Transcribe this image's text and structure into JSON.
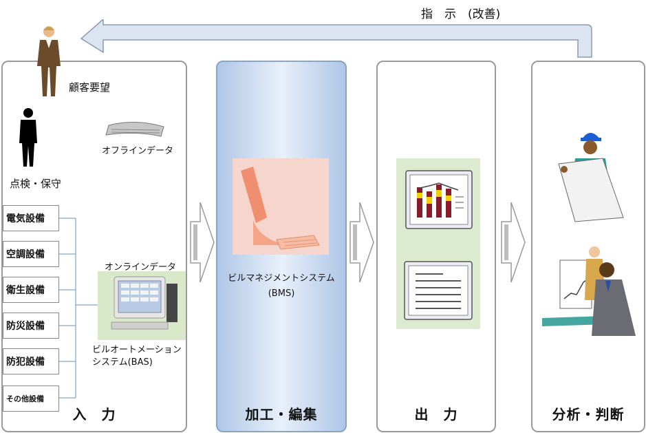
{
  "feedback": {
    "label": "指　示　(改善)"
  },
  "panels": {
    "input": {
      "title": "入　力",
      "customer_label": "顧客要望",
      "inspection_label": "点検・保守",
      "offline_label": "オフラインデータ",
      "online_label": "オンラインデータ",
      "bas_label": "ビルオートメーション\nシステム(BAS)",
      "equipment": [
        "電気設備",
        "空調設備",
        "衛生設備",
        "防災設備",
        "防犯設備",
        "その他設備"
      ]
    },
    "process": {
      "title": "加工・編集",
      "bms_label": "ビルマネジメントシステム\n(BMS)"
    },
    "output": {
      "title": "出　力"
    },
    "analysis": {
      "title": "分析・判断"
    }
  },
  "colors": {
    "panel_border": "#9a9a9a",
    "process_panel": "#aec6e6",
    "arrow_fill": "#ffffff",
    "arrow_stroke": "#9a9a9a",
    "feedback_arrow": "#dbe4ef"
  }
}
